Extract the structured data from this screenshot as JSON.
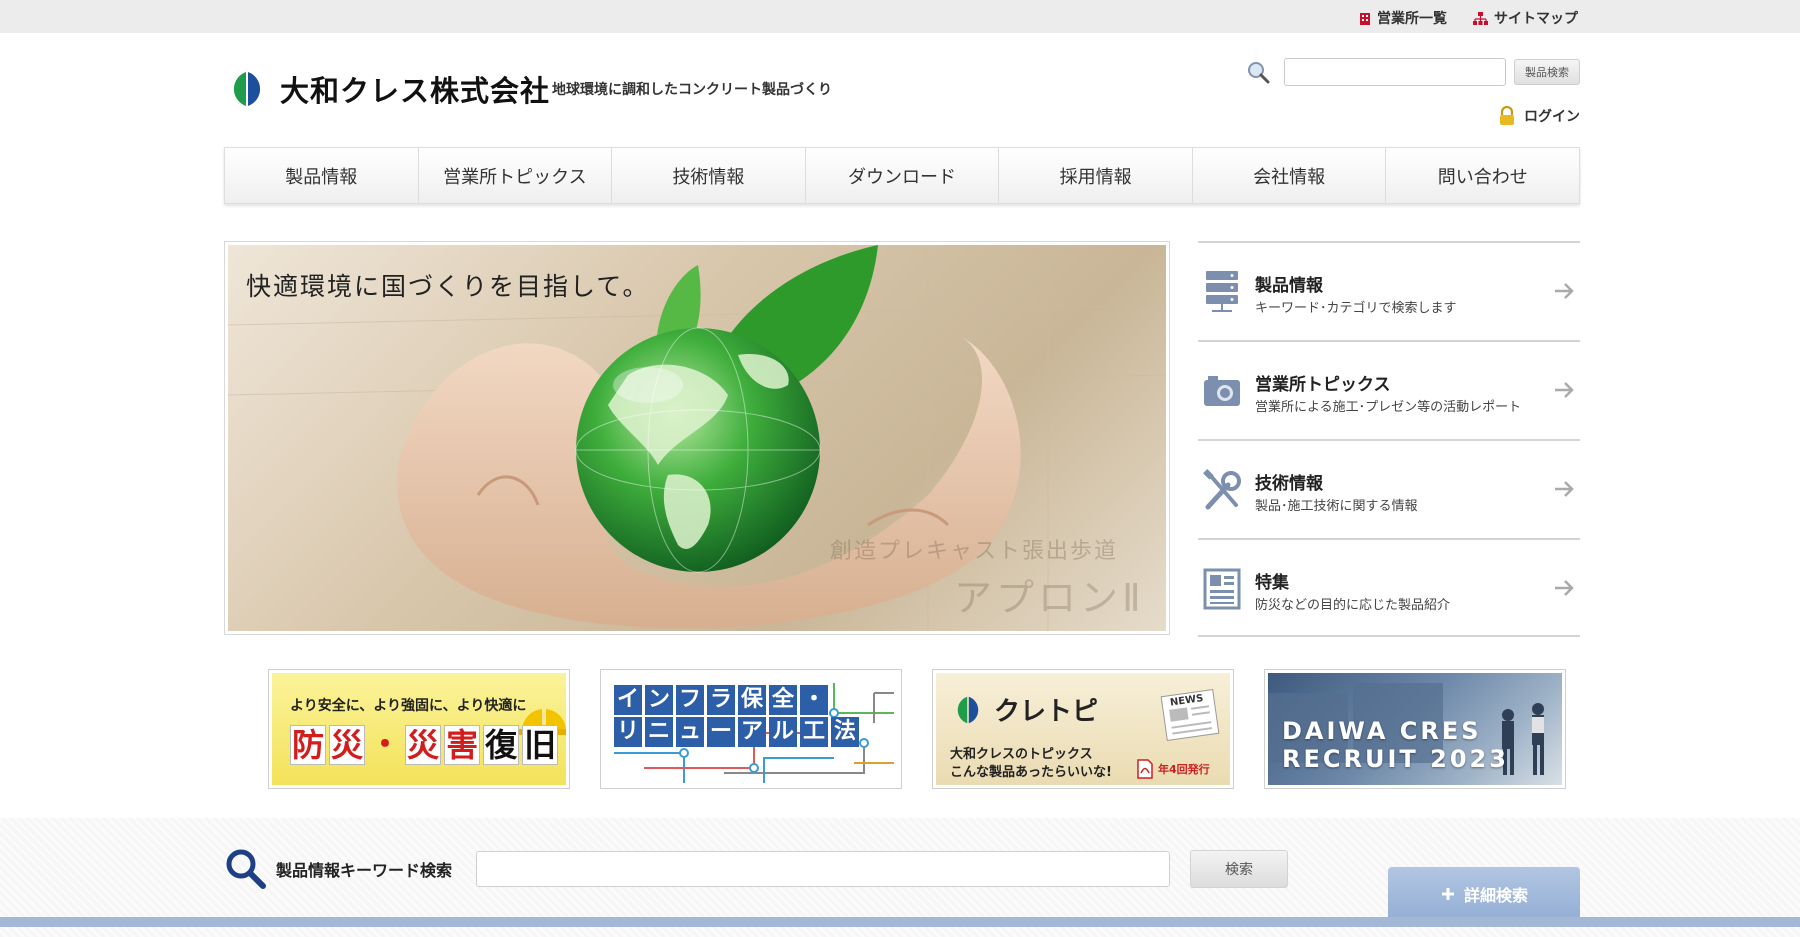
{
  "utility": {
    "offices_label": "営業所一覧",
    "sitemap_label": "サイトマップ"
  },
  "header": {
    "company_name": "大和クレス株式会社",
    "tagline": "地球環境に調和したコンクリート製品づくり",
    "search_button": "製品検索",
    "search_value": "",
    "login_label": "ログイン"
  },
  "nav": {
    "items": [
      "製品情報",
      "営業所トピックス",
      "技術情報",
      "ダウンロード",
      "採用情報",
      "会社情報",
      "問い合わせ"
    ]
  },
  "hero": {
    "caption": "快適環境に国づくりを目指して。",
    "watermark_line1": "創造プレキャスト張出歩道",
    "watermark_line2": "アプロンⅡ"
  },
  "side_menu": [
    {
      "title": "製品情報",
      "desc": "キーワード･カテゴリで検索します",
      "icon": "server-icon"
    },
    {
      "title": "営業所トピックス",
      "desc": "営業所による施工･プレゼン等の活動レポート",
      "icon": "camera-icon"
    },
    {
      "title": "技術情報",
      "desc": "製品･施工技術に関する情報",
      "icon": "tools-icon"
    },
    {
      "title": "特集",
      "desc": "防災などの目的に応じた製品紹介",
      "icon": "layout-icon"
    }
  ],
  "banners": {
    "disaster": {
      "sub": "より安全に、より強固に、より快適に",
      "chars": [
        "防",
        "災",
        "・",
        "災",
        "害",
        "復",
        "旧"
      ]
    },
    "infra": {
      "line1": [
        "イ",
        "ン",
        "フ",
        "ラ",
        "保",
        "全",
        "・"
      ],
      "line2": [
        "リ",
        "ニ",
        "ュ",
        "ー",
        "ア",
        "ル",
        "工",
        "法"
      ]
    },
    "kuretopi": {
      "title": "クレトピ",
      "line1": "大和クレスのトピックス",
      "line2": "こんな製品あったらいいな!",
      "pdf_label": "年4回発行",
      "news_label": "NEWS"
    },
    "recruit": {
      "line1": "DAIWA CRES",
      "line2": "RECRUIT 2023"
    }
  },
  "keyword_search": {
    "label": "製品情報キーワード検索",
    "value": "",
    "button": "検索",
    "detail_label": "詳細検索"
  },
  "colors": {
    "brand_green": "#1f9d4a",
    "brand_blue": "#1c4f9c",
    "accent_blue": "#93aed5"
  }
}
